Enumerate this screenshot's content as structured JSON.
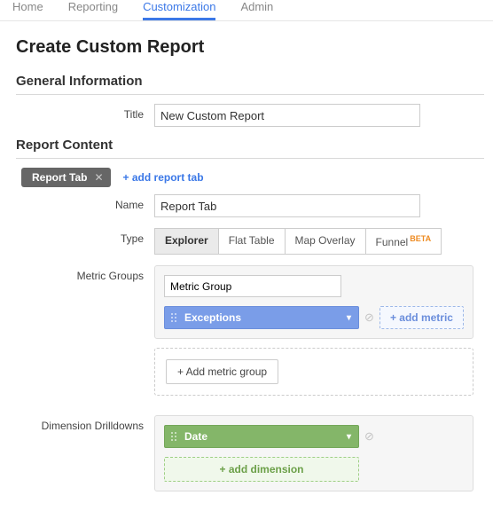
{
  "nav": {
    "items": [
      "Home",
      "Reporting",
      "Customization",
      "Admin"
    ],
    "activeIndex": 2
  },
  "page": {
    "title": "Create Custom Report"
  },
  "sections": {
    "general": {
      "heading": "General Information",
      "titleLabel": "Title",
      "titleValue": "New Custom Report"
    },
    "content": {
      "heading": "Report Content",
      "reportTabPill": "Report Tab",
      "addReportTab": "+ add report tab",
      "nameLabel": "Name",
      "nameValue": "Report Tab",
      "typeLabel": "Type",
      "typeOptions": [
        "Explorer",
        "Flat Table",
        "Map Overlay"
      ],
      "typeFunnel": "Funnel",
      "typeBeta": "BETA",
      "typeSelected": 0,
      "metricGroupsLabel": "Metric Groups",
      "metricGroupTitle": "Metric Group",
      "metricChip": "Exceptions",
      "addMetric": "+ add metric",
      "addMetricGroup": "+ Add metric group",
      "dimLabel": "Dimension Drilldowns",
      "dimChip": "Date",
      "addDimension": "+ add dimension"
    }
  }
}
